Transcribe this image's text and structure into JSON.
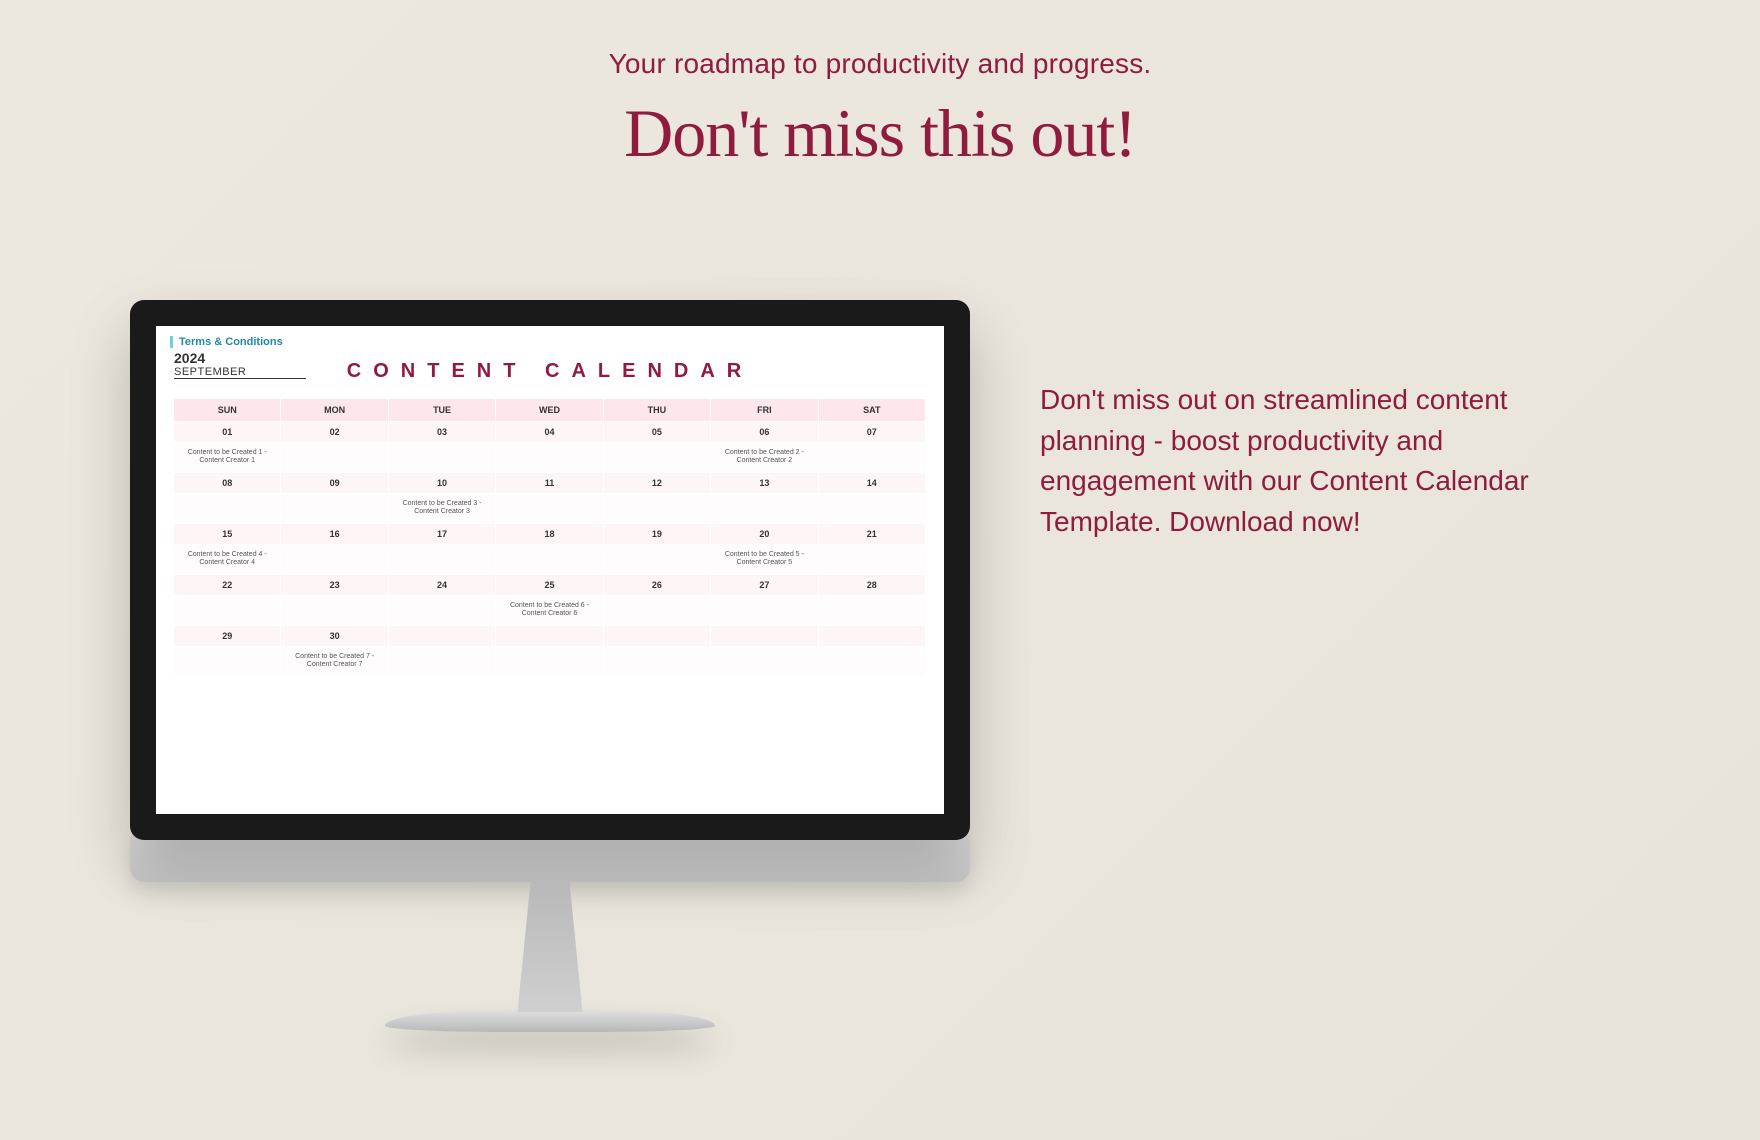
{
  "headline": {
    "subtitle": "Your roadmap to productivity and progress.",
    "title": "Don't miss this out!"
  },
  "body_copy": "Don't miss out on streamlined content planning - boost productivity and engagement with our Content Calendar Template. Download now!",
  "screen": {
    "terms_label": "Terms & Conditions",
    "year": "2024",
    "month": "SEPTEMBER",
    "title": "CONTENT CALENDAR",
    "days": [
      "SUN",
      "MON",
      "TUE",
      "WED",
      "THU",
      "FRI",
      "SAT"
    ],
    "weeks": [
      {
        "dates": [
          "01",
          "02",
          "03",
          "04",
          "05",
          "06",
          "07"
        ],
        "content": [
          "Content to be Created 1 - Content Creator 1",
          "",
          "",
          "",
          "",
          "Content to be Created 2 - Content Creator 2",
          ""
        ]
      },
      {
        "dates": [
          "08",
          "09",
          "10",
          "11",
          "12",
          "13",
          "14"
        ],
        "content": [
          "",
          "",
          "Content to be Created 3 - Content Creator 3",
          "",
          "",
          "",
          ""
        ]
      },
      {
        "dates": [
          "15",
          "16",
          "17",
          "18",
          "19",
          "20",
          "21"
        ],
        "content": [
          "Content to be Created 4 - Content Creator 4",
          "",
          "",
          "",
          "",
          "Content to be Created 5 - Content Creator 5",
          ""
        ]
      },
      {
        "dates": [
          "22",
          "23",
          "24",
          "25",
          "26",
          "27",
          "28"
        ],
        "content": [
          "",
          "",
          "",
          "Content to be Created 6 - Content Creator 6",
          "",
          "",
          ""
        ]
      },
      {
        "dates": [
          "29",
          "30",
          "",
          "",
          "",
          "",
          ""
        ],
        "content": [
          "",
          "Content to be Created 7 - Content Creator 7",
          "",
          "",
          "",
          "",
          ""
        ]
      }
    ]
  }
}
